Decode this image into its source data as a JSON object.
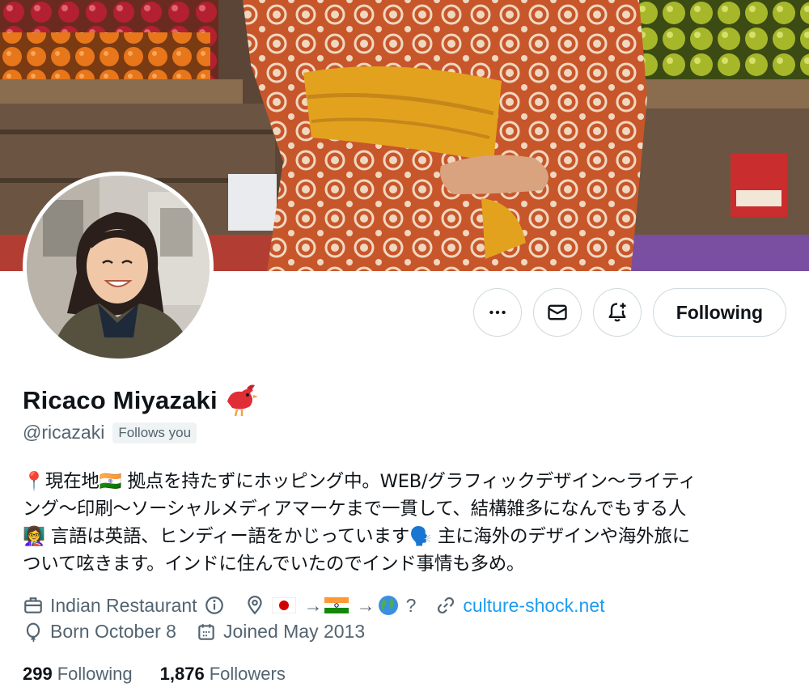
{
  "profile": {
    "display_name": "Ricaco Miyazaki",
    "name_emoji": "bird-emoji",
    "handle": "@ricazaki",
    "follows_you": "Follows you"
  },
  "actions": {
    "more_icon": "more-icon",
    "message_icon": "envelope-icon",
    "notify_icon": "bell-plus-icon",
    "following_label": "Following"
  },
  "bio": {
    "line1": "📍現在地🇮🇳 拠点を持たずにホッピング中。WEB/グラフィックデザイン〜ライティ",
    "line2": "ング〜印刷〜ソーシャルメディアマーケまで一貫して、結構雑多になんでもする人",
    "line3": "👩‍🏫 言語は英語、ヒンディー語をかじっています🗣️ 主に海外のデザインや海外旅に",
    "line4": "ついて呟きます。インドに住んでいたのでインド事情も多め。"
  },
  "meta": {
    "category": "Indian Restaurant",
    "location_suffix": "?",
    "website": "culture-shock.net",
    "birthday": "Born October 8",
    "joined": "Joined May 2013"
  },
  "counts": {
    "following_count": "299",
    "following_label": "Following",
    "followers_count": "1,876",
    "followers_label": "Followers"
  },
  "colors": {
    "text_primary": "#0f1419",
    "text_secondary": "#536471",
    "link": "#1d9bf0",
    "border": "#cfd9de"
  }
}
